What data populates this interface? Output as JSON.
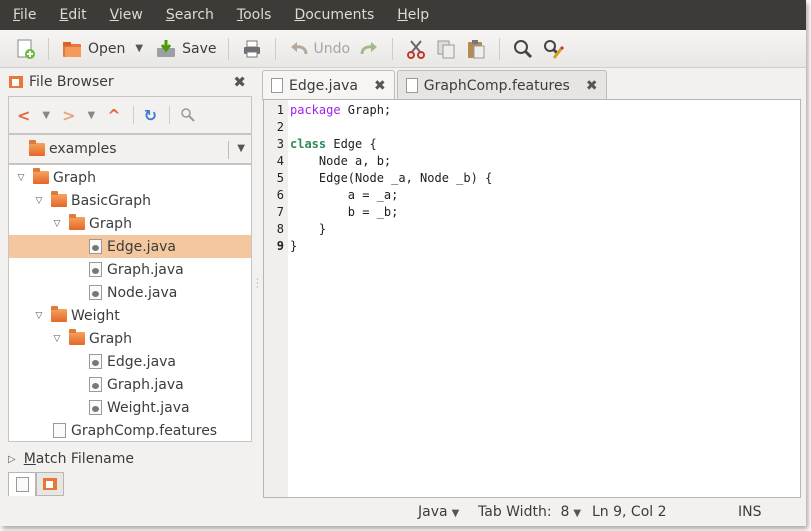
{
  "menubar": {
    "items": [
      {
        "label": "File",
        "key": "F",
        "rest": "ile"
      },
      {
        "label": "Edit",
        "key": "E",
        "rest": "dit"
      },
      {
        "label": "View",
        "key": "V",
        "rest": "iew"
      },
      {
        "label": "Search",
        "key": "S",
        "rest": "earch"
      },
      {
        "label": "Tools",
        "key": "T",
        "rest": "ools"
      },
      {
        "label": "Documents",
        "key": "D",
        "rest": "ocuments"
      },
      {
        "label": "Help",
        "key": "H",
        "rest": "elp"
      }
    ]
  },
  "toolbar": {
    "open_label": "Open",
    "save_label": "Save",
    "undo_label": "Undo"
  },
  "side_panel": {
    "title": "File Browser",
    "location": "examples",
    "tree": [
      {
        "label": "Graph",
        "depth": 0,
        "kind": "folder",
        "expanded": true
      },
      {
        "label": "BasicGraph",
        "depth": 1,
        "kind": "folder",
        "expanded": true
      },
      {
        "label": "Graph",
        "depth": 2,
        "kind": "folder",
        "expanded": true
      },
      {
        "label": "Edge.java",
        "depth": 3,
        "kind": "java",
        "selected": true
      },
      {
        "label": "Graph.java",
        "depth": 3,
        "kind": "java"
      },
      {
        "label": "Node.java",
        "depth": 3,
        "kind": "java"
      },
      {
        "label": "Weight",
        "depth": 1,
        "kind": "folder",
        "expanded": true
      },
      {
        "label": "Graph",
        "depth": 2,
        "kind": "folder",
        "expanded": true
      },
      {
        "label": "Edge.java",
        "depth": 3,
        "kind": "java"
      },
      {
        "label": "Graph.java",
        "depth": 3,
        "kind": "java"
      },
      {
        "label": "Weight.java",
        "depth": 3,
        "kind": "java"
      },
      {
        "label": "GraphComp.features",
        "depth": 1,
        "kind": "plain"
      }
    ],
    "match_key": "M",
    "match_rest": "atch Filename"
  },
  "editor": {
    "tabs": [
      {
        "label": "Edge.java",
        "active": true
      },
      {
        "label": "GraphComp.features",
        "active": false
      }
    ],
    "lines": [
      {
        "num": "1",
        "parts": [
          {
            "t": "package",
            "c": "kw1"
          },
          {
            "t": " Graph;",
            "c": ""
          }
        ]
      },
      {
        "num": "2",
        "parts": []
      },
      {
        "num": "3",
        "parts": [
          {
            "t": "class",
            "c": "kw2"
          },
          {
            "t": " Edge {",
            "c": ""
          }
        ]
      },
      {
        "num": "4",
        "parts": [
          {
            "t": "    Node a, b;",
            "c": ""
          }
        ]
      },
      {
        "num": "5",
        "parts": [
          {
            "t": "    Edge(Node _a, Node _b) {",
            "c": ""
          }
        ]
      },
      {
        "num": "6",
        "parts": [
          {
            "t": "        a = _a;",
            "c": ""
          }
        ]
      },
      {
        "num": "7",
        "parts": [
          {
            "t": "        b = _b;",
            "c": ""
          }
        ]
      },
      {
        "num": "8",
        "parts": [
          {
            "t": "    }",
            "c": ""
          }
        ]
      },
      {
        "num": "9",
        "parts": [
          {
            "t": "}",
            "c": ""
          }
        ],
        "current": true
      }
    ]
  },
  "statusbar": {
    "language": "Java",
    "tab_width": "Tab Width:  8",
    "position": "Ln 9, Col 2",
    "mode": "INS"
  },
  "colors": {
    "menubar_bg": "#3c3b37",
    "selection": "#f5c79f",
    "keyword_purple": "#a020f0",
    "keyword_green": "#2e8b57",
    "folder_orange": "#e2672b"
  }
}
